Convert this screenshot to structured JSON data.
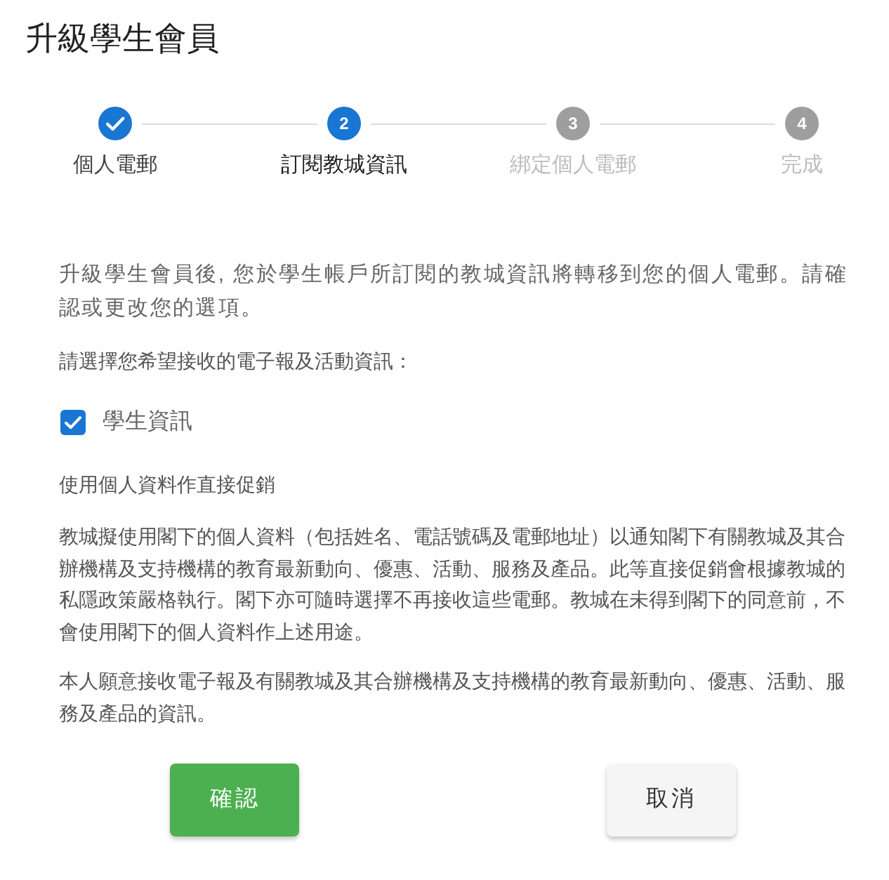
{
  "title": "升級學生會員",
  "steps": [
    {
      "label": "個人電郵",
      "completed": true,
      "selected": false
    },
    {
      "number": "2",
      "label": "訂閱教城資訊",
      "completed": false,
      "selected": true
    },
    {
      "number": "3",
      "label": "綁定個人電郵",
      "completed": false,
      "selected": false
    },
    {
      "number": "4",
      "label": "完成",
      "completed": false,
      "selected": false
    }
  ],
  "intro": "升級學生會員後, 您於學生帳戶所訂閱的教城資訊將轉移到您的個人電郵。請確認或更改您的選項。",
  "prompt": "請選擇您希望接收的電子報及活動資訊：",
  "options": [
    {
      "label": "學生資訊",
      "checked": true
    }
  ],
  "consent": {
    "heading": "使用個人資料作直接促銷",
    "paragraphs": [
      "教城擬使用閣下的個人資料（包括姓名、電話號碼及電郵地址）以通知閣下有關教城及其合辦機構及支持機構的教育最新動向、優惠、活動、服務及產品。此等直接促銷會根據教城的私隱政策嚴格執行。閣下亦可隨時選擇不再接收這些電郵。教城在未得到閣下的同意前，不會使用閣下的個人資料作上述用途。",
      "本人願意接收電子報及有關教城及其合辦機構及支持機構的教育最新動向、優惠、活動、服務及產品的資訊。"
    ]
  },
  "buttons": [
    {
      "label": "確認",
      "kind": "primary"
    },
    {
      "label": "取消",
      "kind": "secondary"
    }
  ]
}
